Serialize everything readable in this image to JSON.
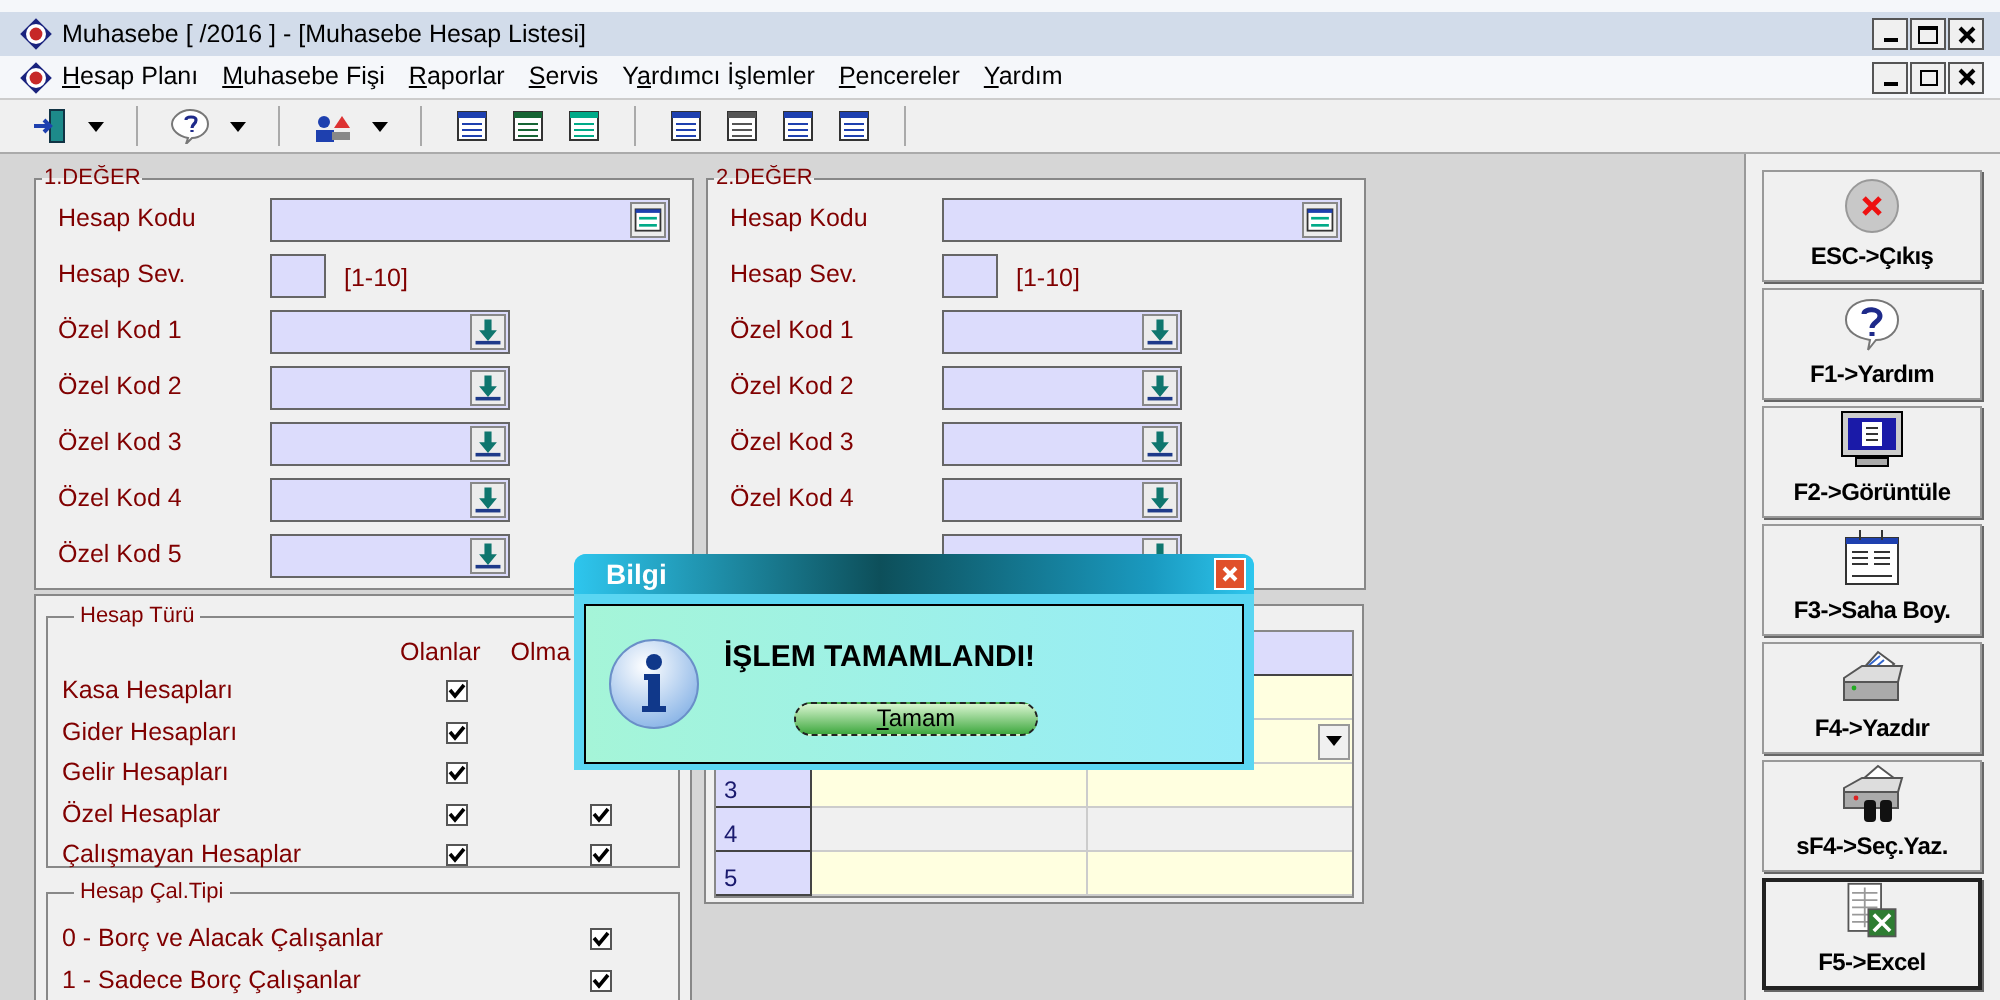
{
  "window": {
    "title": "Muhasebe [ /2016 ]  - [Muhasebe Hesap Listesi]"
  },
  "menu": [
    {
      "key": "H",
      "post": "esap Planı"
    },
    {
      "key": "M",
      "post": "uhasebe Fişi"
    },
    {
      "key": "R",
      "post": "aporlar"
    },
    {
      "key": "S",
      "post": "ervis"
    },
    {
      "pre": "Y",
      "key": "a",
      "post": "rdımcı İşlemler"
    },
    {
      "key": "P",
      "post": "encereler"
    },
    {
      "key": "Y",
      "post": "ardım"
    }
  ],
  "value_panels": [
    {
      "title": "1.DEĞER",
      "fields": [
        {
          "kind": "code",
          "label": "Hesap Kodu"
        },
        {
          "kind": "level",
          "label": "Hesap Sev.",
          "hint": "[1-10]"
        },
        {
          "kind": "special",
          "label": "Özel Kod 1"
        },
        {
          "kind": "special",
          "label": "Özel Kod 2"
        },
        {
          "kind": "special",
          "label": "Özel Kod 3"
        },
        {
          "kind": "special",
          "label": "Özel Kod 4"
        },
        {
          "kind": "special",
          "label": "Özel Kod 5"
        }
      ]
    },
    {
      "title": "2.DEĞER",
      "fields": [
        {
          "kind": "code",
          "label": "Hesap Kodu"
        },
        {
          "kind": "level",
          "label": "Hesap Sev.",
          "hint": "[1-10]"
        },
        {
          "kind": "special",
          "label": "Özel Kod 1"
        },
        {
          "kind": "special",
          "label": "Özel Kod 2"
        },
        {
          "kind": "special",
          "label": "Özel Kod 3"
        },
        {
          "kind": "special",
          "label": "Özel Kod 4"
        },
        {
          "kind": "special"
        }
      ]
    }
  ],
  "account_types": {
    "title": "Hesap Türü",
    "columns": [
      "Olanlar",
      "Olma"
    ],
    "rows": [
      {
        "label": "Kasa Hesapları",
        "with": true
      },
      {
        "label": "Gider Hesapları",
        "with": true
      },
      {
        "label": "Gelir Hesapları",
        "with": true
      },
      {
        "label": "Özel Hesaplar",
        "with": true,
        "without": true
      },
      {
        "label": "Çalışmayan Hesaplar",
        "with": true,
        "without": true
      }
    ]
  },
  "working_type": {
    "title": "Hesap Çal.Tipi",
    "rows": [
      {
        "label": "0 - Borç ve Alacak Çalışanlar",
        "checked": true
      },
      {
        "label": "1 - Sadece Borç Çalışanlar",
        "checked": true
      }
    ]
  },
  "grid": {
    "rows": [
      {
        "dropdown": false,
        "selected": false
      },
      {
        "dropdown": true,
        "selected": false
      },
      {
        "number": "3",
        "dropdown": false,
        "selected": false
      },
      {
        "number": "4",
        "dropdown": false,
        "selected": true
      },
      {
        "number": "5",
        "dropdown": false,
        "selected": false
      }
    ]
  },
  "side_buttons": [
    {
      "kind": "exit",
      "label": "ESC->Çıkış"
    },
    {
      "kind": "help",
      "label": "F1->Yardım"
    },
    {
      "kind": "display",
      "label": "F2->Görüntüle"
    },
    {
      "kind": "columns",
      "label": "F3->Saha Boy."
    },
    {
      "kind": "print",
      "label": "F4->Yazdır"
    },
    {
      "kind": "select_print",
      "label": "sF4->Seç.Yaz."
    },
    {
      "kind": "excel",
      "label": "F5->Excel"
    }
  ],
  "dialog": {
    "title": "Bilgi",
    "message": "İŞLEM TAMAMLANDI!",
    "button": {
      "key": "T",
      "post": "amam"
    }
  }
}
